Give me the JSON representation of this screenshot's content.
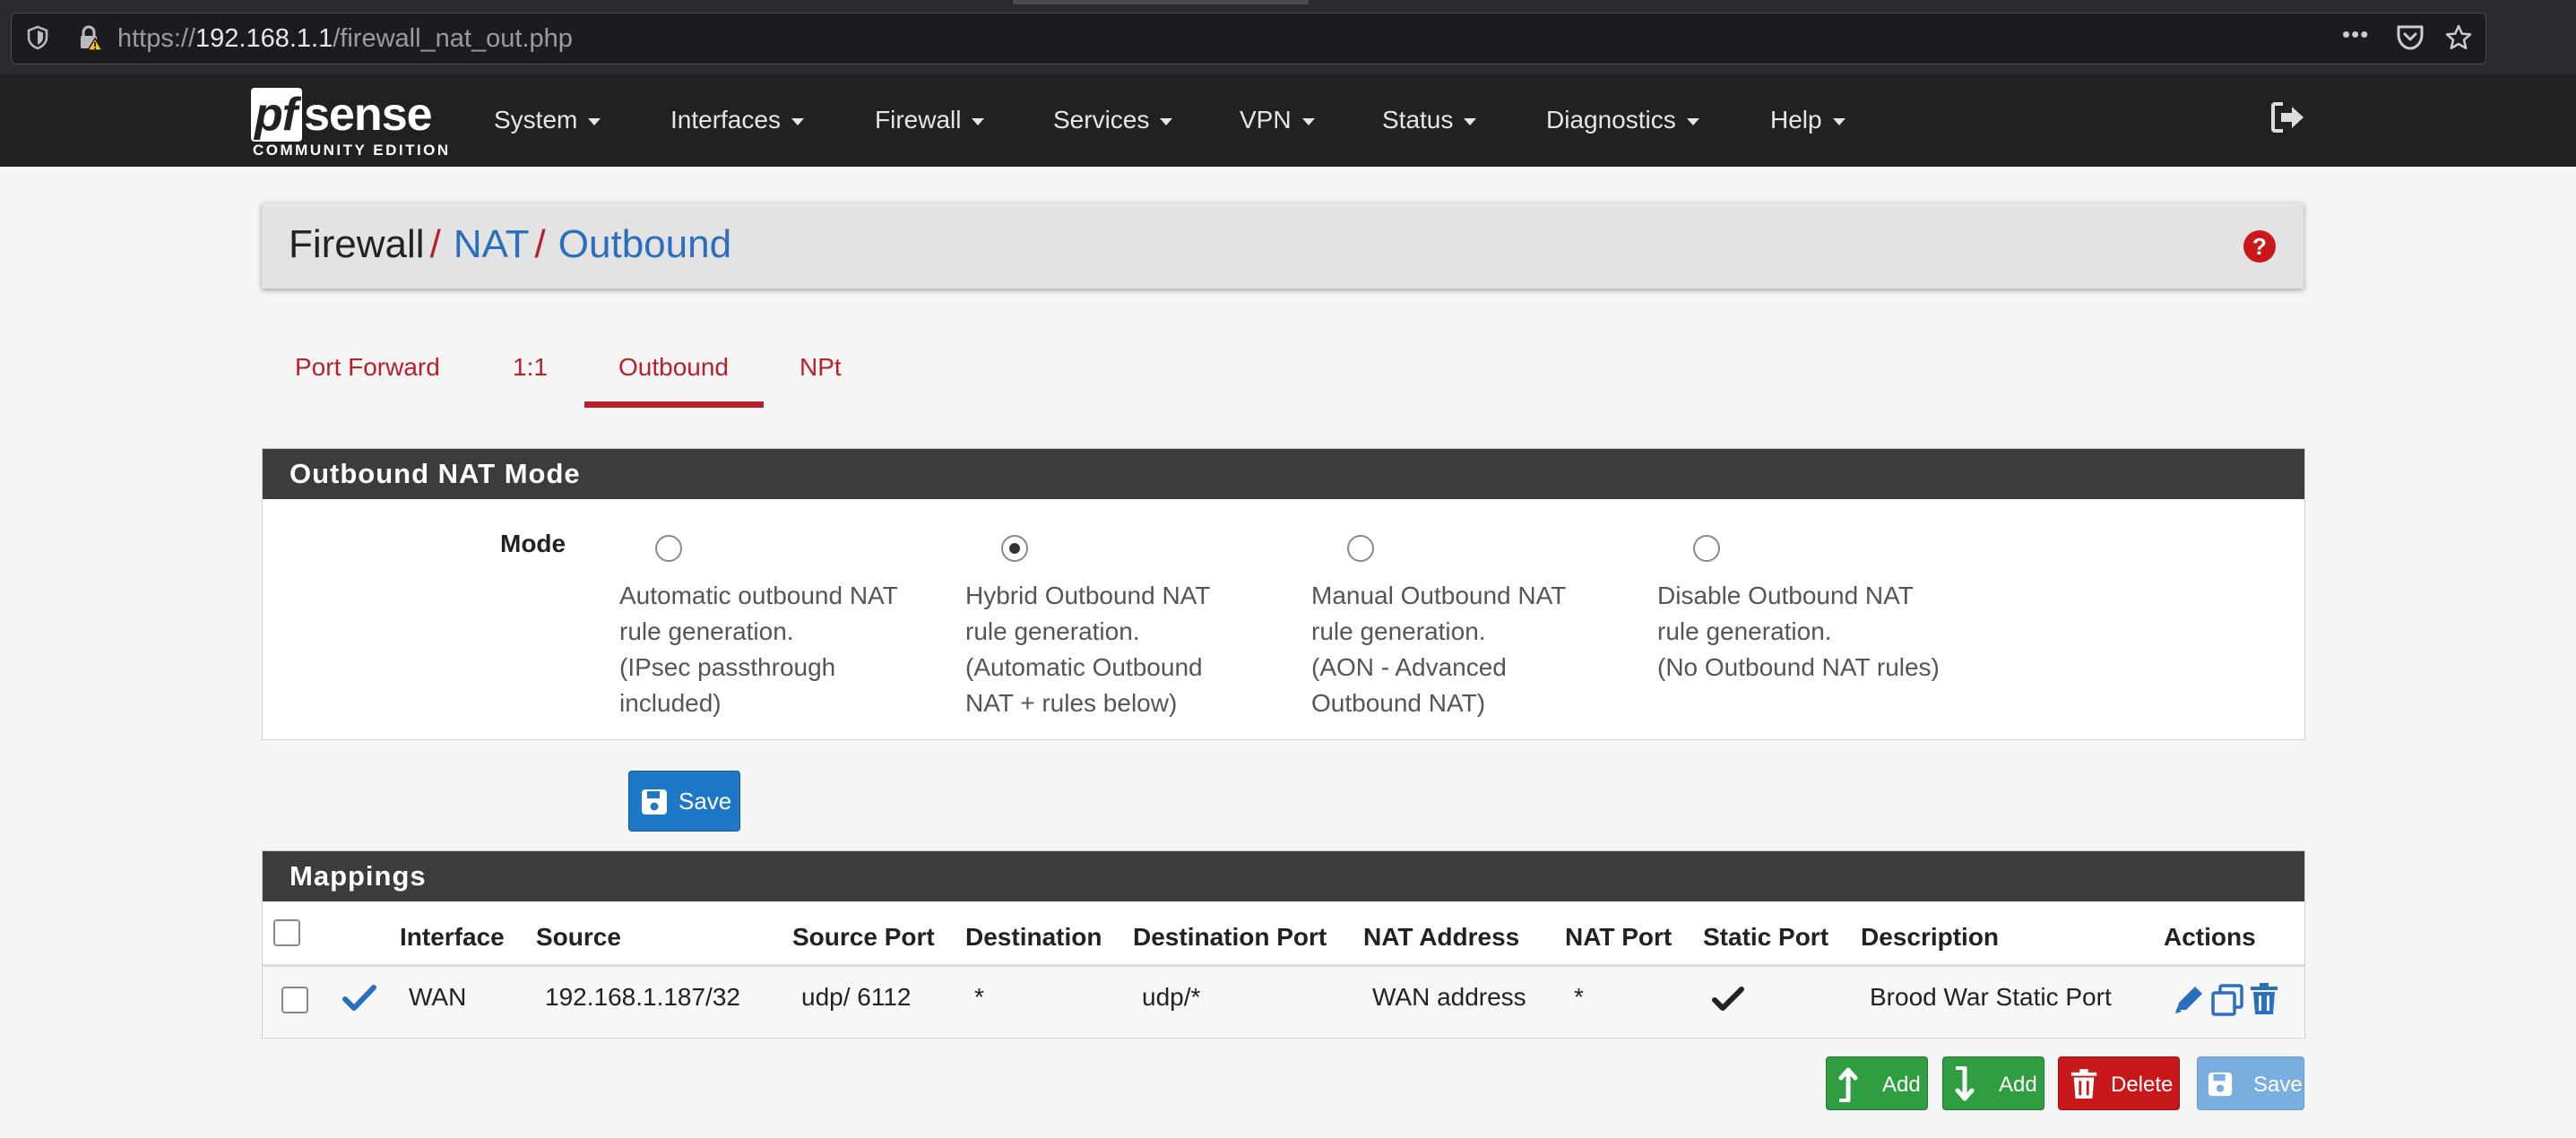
{
  "browser": {
    "url_scheme": "https://",
    "url_host": "192.168.1.1",
    "url_path": "/firewall_nat_out.php",
    "menu_dots": "•••"
  },
  "navbar": {
    "logo_pf": "pf",
    "logo_sense": "sense",
    "logo_sub": "COMMUNITY EDITION",
    "items": [
      "System",
      "Interfaces",
      "Firewall",
      "Services",
      "VPN",
      "Status",
      "Diagnostics",
      "Help"
    ]
  },
  "breadcrumb": {
    "part1": "Firewall",
    "sep": "/",
    "part2": "NAT",
    "part3": "Outbound"
  },
  "tabs": {
    "items": [
      "Port Forward",
      "1:1",
      "Outbound",
      "NPt"
    ],
    "active": "Outbound"
  },
  "outbound_mode": {
    "title": "Outbound NAT Mode",
    "label": "Mode",
    "options": [
      {
        "lines": [
          "Automatic outbound NAT",
          "rule generation.",
          "(IPsec passthrough",
          "included)"
        ],
        "checked": false
      },
      {
        "lines": [
          "Hybrid Outbound NAT",
          "rule generation.",
          "(Automatic Outbound",
          "NAT + rules below)"
        ],
        "checked": true
      },
      {
        "lines": [
          "Manual Outbound NAT",
          "rule generation.",
          "(AON - Advanced",
          "Outbound NAT)"
        ],
        "checked": false
      },
      {
        "lines": [
          "Disable Outbound NAT",
          "rule generation.",
          "(No Outbound NAT rules)"
        ],
        "checked": false
      }
    ],
    "save_label": "Save"
  },
  "mappings": {
    "title": "Mappings",
    "columns": [
      "Interface",
      "Source",
      "Source Port",
      "Destination",
      "Destination Port",
      "NAT Address",
      "NAT Port",
      "Static Port",
      "Description",
      "Actions"
    ],
    "rows": [
      {
        "interface": "WAN",
        "source": "192.168.1.187/32",
        "source_port": "udp/ 6112",
        "destination": "*",
        "destination_port": "udp/*",
        "nat_address": "WAN address",
        "nat_port": "*",
        "static_port": "check-icon",
        "description": "Brood War Static Port"
      }
    ],
    "buttons": {
      "add_top": "Add",
      "add_bottom": "Add",
      "delete": "Delete",
      "save": "Save"
    }
  },
  "colors": {
    "navbar_bg": "#212121",
    "accent_red": "#b8202a",
    "link_blue": "#2a6fbf",
    "panel_head": "#3c3c3c",
    "btn_blue": "#1e78c8",
    "btn_green": "#2f9e41",
    "btn_red": "#c9181c"
  }
}
